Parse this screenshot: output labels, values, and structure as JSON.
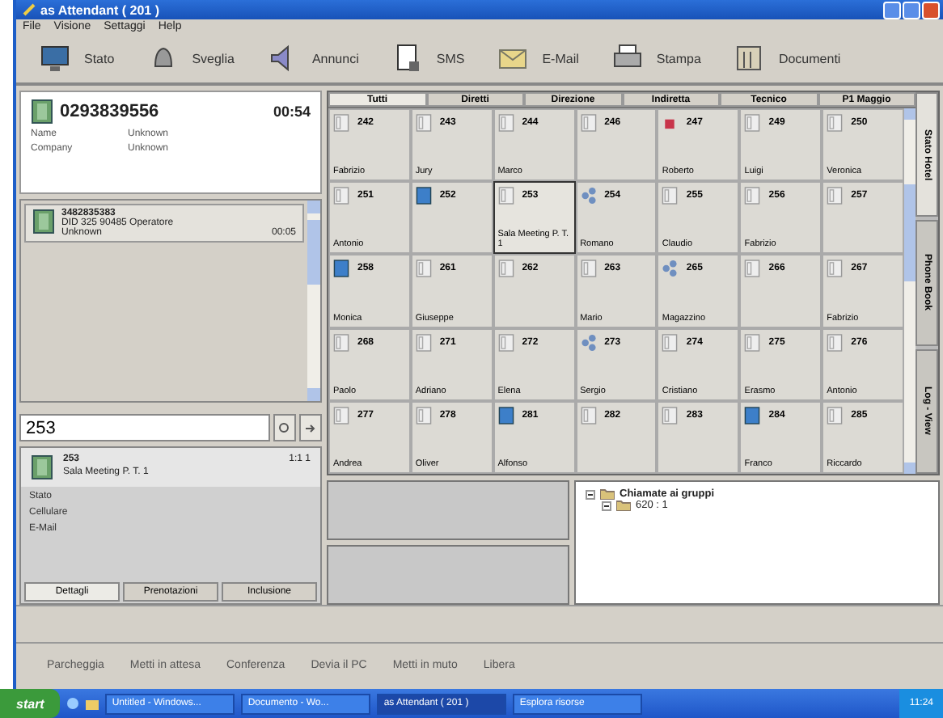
{
  "window": {
    "title": "as Attendant ( 201 )"
  },
  "menu": [
    "File",
    "Visione",
    "Settaggi",
    "Help"
  ],
  "toolbar": [
    {
      "label": "Stato",
      "kind": "monitor"
    },
    {
      "label": "Sveglia",
      "kind": "bell"
    },
    {
      "label": "Annunci",
      "kind": "speaker"
    },
    {
      "label": "SMS",
      "kind": "sms"
    },
    {
      "label": "E-Mail",
      "kind": "mail"
    },
    {
      "label": "Stampa",
      "kind": "printer"
    },
    {
      "label": "Documenti",
      "kind": "book"
    }
  ],
  "active_call": {
    "number": "0293839556",
    "duration": "00:54",
    "fields": [
      {
        "label": "Name",
        "value": "Unknown"
      },
      {
        "label": "Company",
        "value": "Unknown"
      }
    ]
  },
  "call_list": [
    {
      "number": "3482835383",
      "line": "DID 325 90485 Operatore",
      "name": "Unknown",
      "time": "00:05"
    }
  ],
  "search": {
    "value": "253"
  },
  "detail": {
    "number": "253",
    "code": "1:1 1",
    "name": "Sala Meeting P. T. 1",
    "fields": [
      "Stato",
      "Cellulare",
      "E-Mail"
    ],
    "tabs": [
      {
        "label": "Dettagli",
        "selected": true
      },
      {
        "label": "Prenotazioni",
        "selected": false
      },
      {
        "label": "Inclusione",
        "selected": false
      }
    ]
  },
  "extension_tabs": [
    {
      "label": "Tutti",
      "selected": true
    },
    {
      "label": "Diretti",
      "selected": false
    },
    {
      "label": "Direzione",
      "selected": false
    },
    {
      "label": "Indiretta",
      "selected": false
    },
    {
      "label": "Tecnico",
      "selected": false
    },
    {
      "label": "P1 Maggio",
      "selected": false
    }
  ],
  "side_tabs": [
    {
      "label": "Stato Hotel",
      "selected": true
    },
    {
      "label": "Phone Book",
      "selected": false
    },
    {
      "label": "Log - View",
      "selected": false
    }
  ],
  "extensions": [
    [
      {
        "number": "242",
        "name": "Fabrizio",
        "kind": "free",
        "selected": false
      },
      {
        "number": "243",
        "name": "Jury",
        "kind": "free",
        "selected": false
      },
      {
        "number": "244",
        "name": "Marco",
        "kind": "free",
        "selected": false
      },
      {
        "number": "246",
        "kind": "free",
        "selected": false
      },
      {
        "number": "247",
        "name": "Roberto",
        "kind": "alarm",
        "selected": false
      },
      {
        "number": "249",
        "name": "Luigi",
        "kind": "free",
        "selected": false
      },
      {
        "number": "250",
        "name": "Veronica",
        "kind": "free",
        "selected": false
      }
    ],
    [
      {
        "number": "251",
        "name": "Antonio",
        "kind": "free",
        "selected": false
      },
      {
        "number": "252",
        "kind": "busy",
        "selected": false
      },
      {
        "number": "253",
        "name": "Sala Meeting P. T. 1",
        "kind": "free",
        "selected": true
      },
      {
        "number": "254",
        "name": "Romano",
        "kind": "group",
        "selected": false
      },
      {
        "number": "255",
        "name": "Claudio",
        "kind": "free",
        "selected": false
      },
      {
        "number": "256",
        "name": "Fabrizio",
        "kind": "free",
        "selected": false
      },
      {
        "number": "257",
        "kind": "free",
        "selected": false
      }
    ],
    [
      {
        "number": "258",
        "name": "Monica",
        "kind": "busy",
        "selected": false
      },
      {
        "number": "261",
        "name": "Giuseppe",
        "kind": "free",
        "selected": false
      },
      {
        "number": "262",
        "kind": "free",
        "selected": false
      },
      {
        "number": "263",
        "name": "Mario",
        "kind": "free",
        "selected": false
      },
      {
        "number": "265",
        "name": "Magazzino",
        "kind": "group",
        "selected": false
      },
      {
        "number": "266",
        "kind": "free",
        "selected": false
      },
      {
        "number": "267",
        "name": "Fabrizio",
        "kind": "free",
        "selected": false
      }
    ],
    [
      {
        "number": "268",
        "name": "Paolo",
        "kind": "free",
        "selected": false
      },
      {
        "number": "271",
        "name": "Adriano",
        "kind": "free",
        "selected": false
      },
      {
        "number": "272",
        "name": "Elena",
        "kind": "free",
        "selected": false
      },
      {
        "number": "273",
        "name": "Sergio",
        "kind": "group",
        "selected": false
      },
      {
        "number": "274",
        "name": "Cristiano",
        "kind": "free",
        "selected": false
      },
      {
        "number": "275",
        "name": "Erasmo",
        "kind": "free",
        "selected": false
      },
      {
        "number": "276",
        "name": "Antonio",
        "kind": "free",
        "selected": false
      }
    ],
    [
      {
        "number": "277",
        "name": "Andrea",
        "kind": "free",
        "selected": false
      },
      {
        "number": "278",
        "name": "Oliver",
        "kind": "free",
        "selected": false
      },
      {
        "number": "281",
        "name": "Alfonso",
        "kind": "busy",
        "selected": false
      },
      {
        "number": "282",
        "kind": "free",
        "selected": false
      },
      {
        "number": "283",
        "kind": "free",
        "selected": false
      },
      {
        "number": "284",
        "name": "Franco",
        "kind": "busy",
        "selected": false
      },
      {
        "number": "285",
        "name": "Riccardo",
        "kind": "free",
        "selected": false
      }
    ]
  ],
  "group_tree": [
    {
      "label": "Chiamate ai gruppi",
      "expanded": true,
      "children": [
        {
          "label": "620 : 1",
          "expanded": true
        }
      ]
    }
  ],
  "call_buttons": [
    "Parcheggia",
    "Metti in attesa",
    "Conferenza",
    "Devia il PC",
    "Metti in muto",
    "Libera"
  ],
  "taskbar": {
    "start": "start",
    "items": [
      {
        "label": "Untitled - Windows...",
        "selected": false
      },
      {
        "label": "Documento - Wo...",
        "selected": false
      },
      {
        "label": "as Attendant ( 201 )",
        "selected": true
      },
      {
        "label": "Esplora risorse",
        "selected": false
      }
    ],
    "clock": "11:24"
  }
}
